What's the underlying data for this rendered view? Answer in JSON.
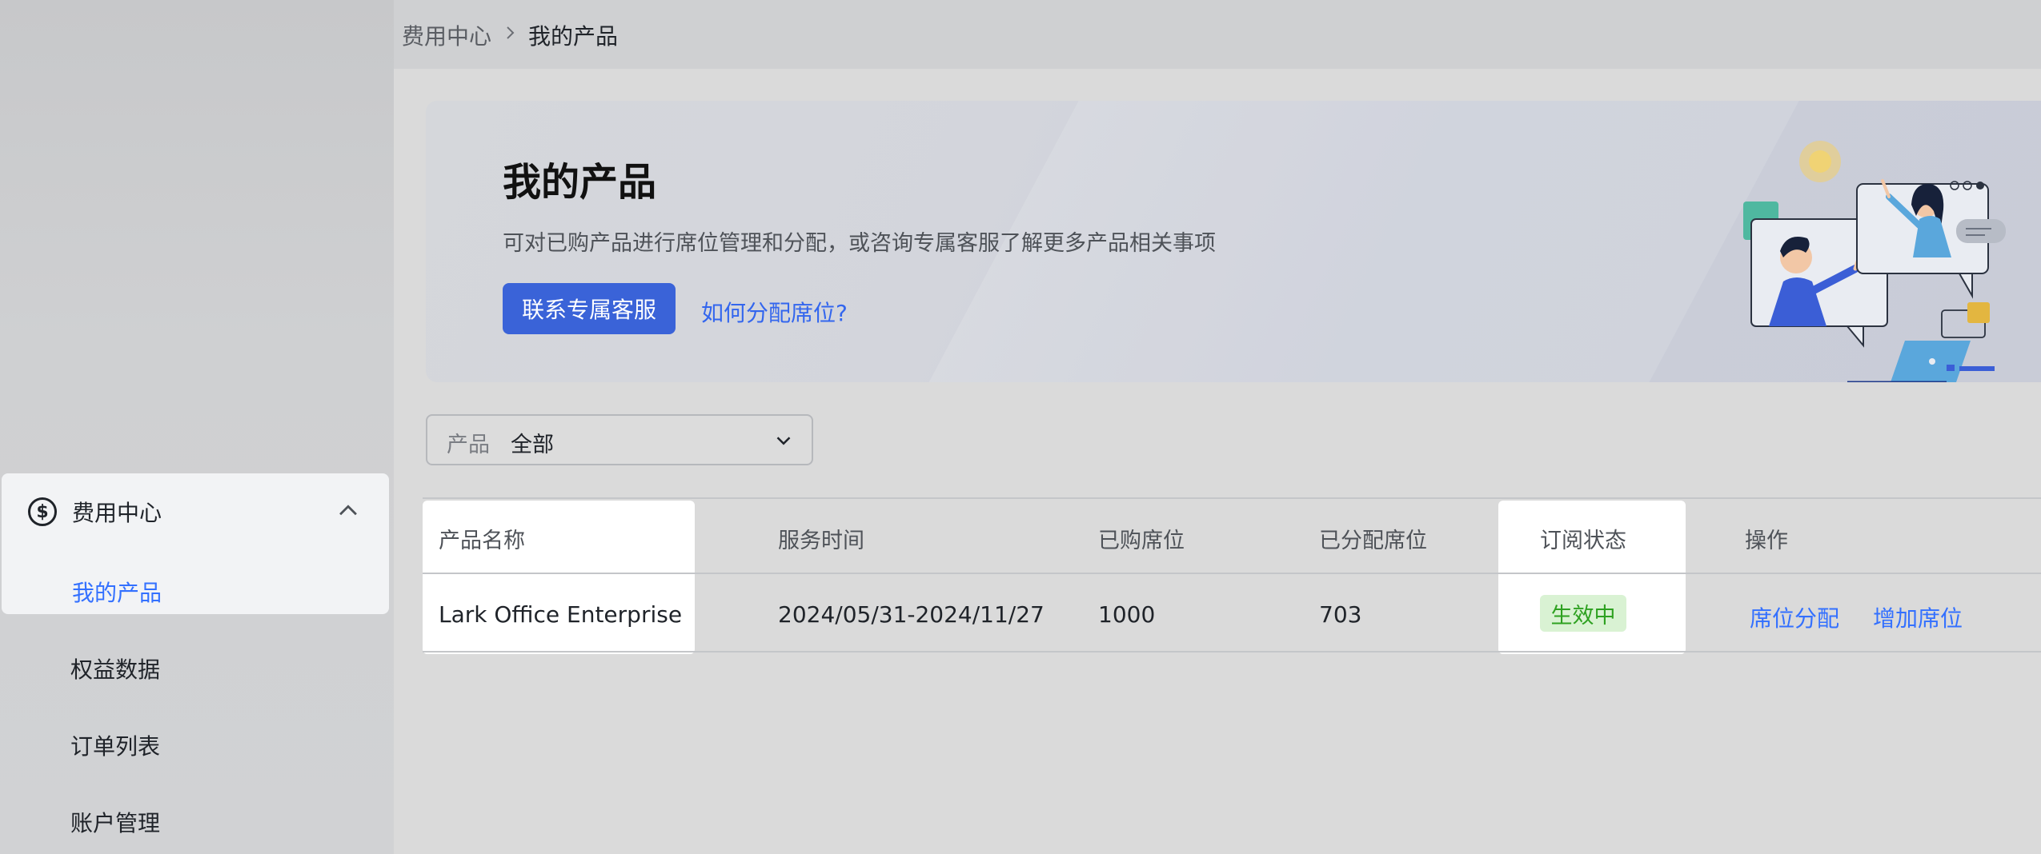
{
  "sidebar": {
    "group_label": "费用中心",
    "items": [
      {
        "label": "我的产品",
        "active": true
      },
      {
        "label": "权益数据",
        "active": false
      },
      {
        "label": "订单列表",
        "active": false
      },
      {
        "label": "账户管理",
        "active": false
      }
    ]
  },
  "breadcrumb": {
    "parent": "费用中心",
    "current": "我的产品"
  },
  "banner": {
    "title": "我的产品",
    "description": "可对已购产品进行席位管理和分配，或咨询专属客服了解更多产品相关事项",
    "primary_button": "联系专属客服",
    "help_link": "如何分配席位?"
  },
  "filter": {
    "label": "产品",
    "value": "全部"
  },
  "table": {
    "headers": [
      "产品名称",
      "服务时间",
      "已购席位",
      "已分配席位",
      "订阅状态",
      "操作"
    ],
    "rows": [
      {
        "name": "Lark Office Enterprise",
        "service_time": "2024/05/31-2024/11/27",
        "purchased": "1000",
        "assigned": "703",
        "status": "生效中",
        "actions": [
          "席位分配",
          "增加席位"
        ]
      }
    ]
  },
  "colors": {
    "accent": "#3370ff",
    "primary_button": "#3a63d8",
    "status_green": "#2ea121",
    "status_bg": "#d9f2d3"
  }
}
